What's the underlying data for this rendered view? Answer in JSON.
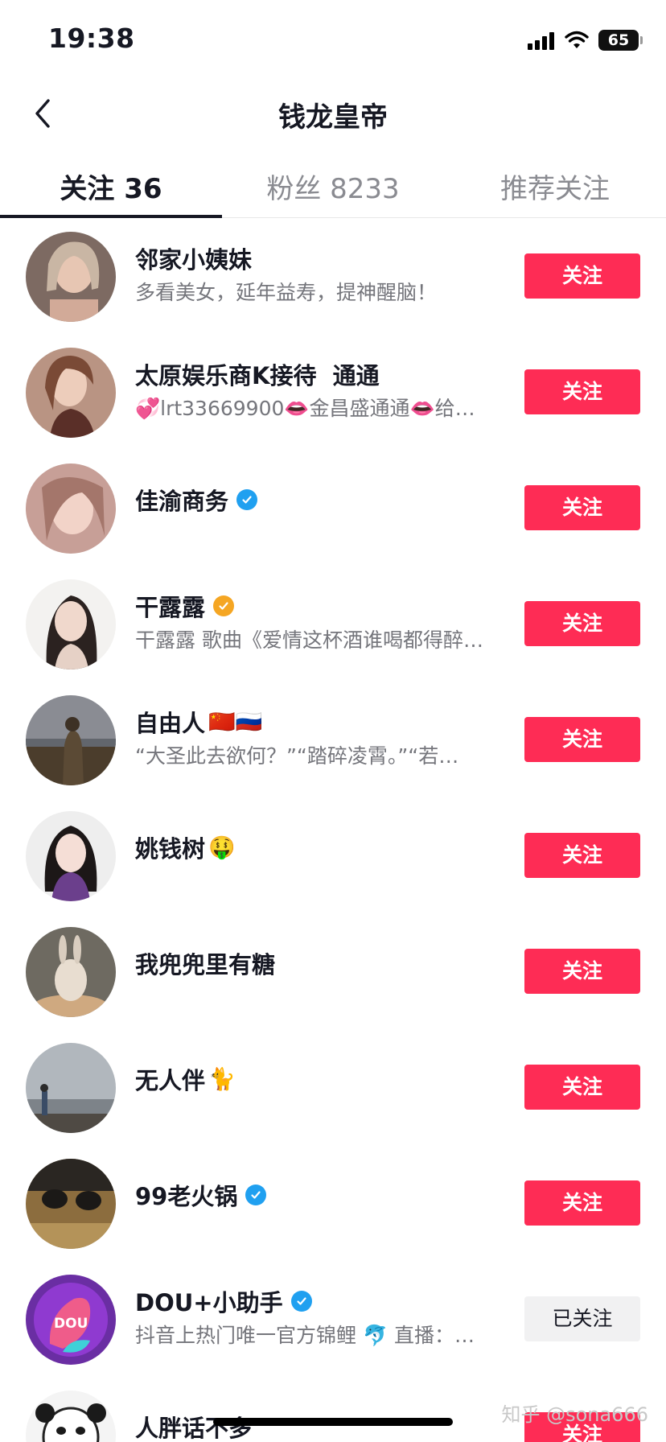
{
  "status_bar": {
    "time": "19:38",
    "battery": "65",
    "icons": [
      "signal-icon",
      "wifi-icon",
      "battery-icon"
    ]
  },
  "nav": {
    "title": "钱龙皇帝",
    "back_icon": "chevron-left-icon"
  },
  "tabs": [
    {
      "label": "关注 36",
      "active": true
    },
    {
      "label": "粉丝 8233",
      "active": false
    },
    {
      "label": "推荐关注",
      "active": false
    }
  ],
  "users": [
    {
      "name": "邻家小姨妹",
      "desc": "多看美女，延年益寿，提神醒脑！",
      "button": "关注",
      "followed": false
    },
    {
      "name": "太原娱乐商K接待  通通",
      "desc": "💞lrt33669900👄金昌盛通通👄给…",
      "button": "关注",
      "followed": false
    },
    {
      "name": "佳渝商务",
      "badge": "blue",
      "desc": "",
      "button": "关注",
      "followed": false
    },
    {
      "name": "干露露",
      "badge": "gold",
      "desc": "干露露 歌曲《爱情这杯酒谁喝都得醉…",
      "button": "关注",
      "followed": false
    },
    {
      "name": "自由人",
      "emoji": "🇨🇳🇷🇺",
      "desc": "“大圣此去欲何？”“踏碎凌霄。”“若…",
      "button": "关注",
      "followed": false
    },
    {
      "name": "姚钱树",
      "emoji": "🤑",
      "desc": "",
      "button": "关注",
      "followed": false
    },
    {
      "name": "我兜兜里有糖",
      "desc": "",
      "button": "关注",
      "followed": false
    },
    {
      "name": "无人伴",
      "emoji": "🐈",
      "desc": "",
      "button": "关注",
      "followed": false
    },
    {
      "name": "99老火锅",
      "badge": "blue",
      "desc": "",
      "button": "关注",
      "followed": false
    },
    {
      "name": "DOU+小助手",
      "badge": "blue",
      "desc": "抖音上热门唯一官方锦鲤 🐬 直播：…",
      "button": "已关注",
      "followed": true
    },
    {
      "name": "人胖话不多",
      "desc": "",
      "button": "关注",
      "followed": false
    }
  ],
  "watermark": "知乎 @sona666",
  "colors": {
    "accent": "#fe2c55",
    "verified_blue": "#20a0f0",
    "verified_gold": "#f5a623",
    "text_primary": "#161823",
    "text_secondary": "#75767c"
  }
}
